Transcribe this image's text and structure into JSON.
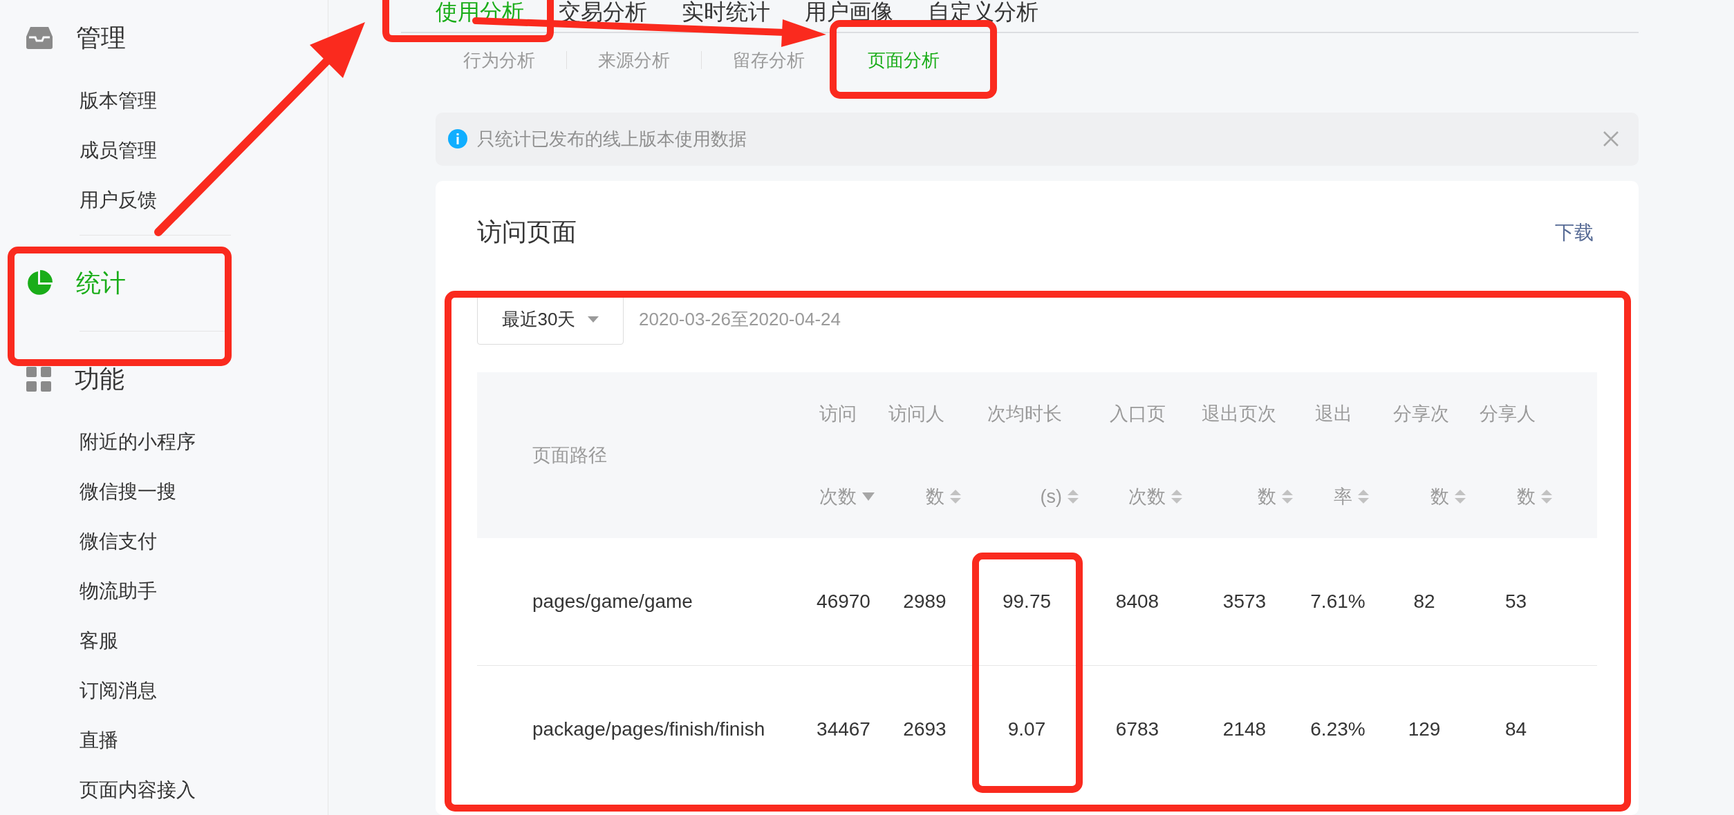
{
  "sidebar": {
    "sections": [
      {
        "label": "管理",
        "selected": false,
        "items": [
          "版本管理",
          "成员管理",
          "用户反馈"
        ]
      },
      {
        "label": "统计",
        "selected": true
      },
      {
        "label": "功能",
        "selected": false,
        "items": [
          "附近的小程序",
          "微信搜一搜",
          "微信支付",
          "物流助手",
          "客服",
          "订阅消息",
          "直播",
          "页面内容接入"
        ]
      }
    ]
  },
  "tabs": [
    {
      "label": "使用分析",
      "selected": true
    },
    {
      "label": "交易分析",
      "selected": false
    },
    {
      "label": "实时统计",
      "selected": false
    },
    {
      "label": "用户画像",
      "selected": false
    },
    {
      "label": "自定义分析",
      "selected": false
    }
  ],
  "subtabs": [
    {
      "label": "行为分析",
      "selected": false
    },
    {
      "label": "来源分析",
      "selected": false
    },
    {
      "label": "留存分析",
      "selected": false
    },
    {
      "label": "页面分析",
      "selected": true
    }
  ],
  "notice": {
    "text": "只统计已发布的线上版本使用数据"
  },
  "card": {
    "title": "访问页面",
    "download": "下载",
    "range_select": {
      "value": "最近30天"
    },
    "date_range": "2020-03-26至2020-04-24"
  },
  "table": {
    "columns": [
      {
        "label": "页面路径",
        "sortable": false
      },
      {
        "label": "访问次数",
        "sortable": true,
        "sorted": true
      },
      {
        "label": "访问人数",
        "sortable": true,
        "sorted": false
      },
      {
        "label": "次均时长(s)",
        "sortable": true,
        "sorted": false
      },
      {
        "label": "入口页次数",
        "sortable": true,
        "sorted": false
      },
      {
        "label": "退出页次数",
        "sortable": true,
        "sorted": false
      },
      {
        "label": "退出率",
        "sortable": true,
        "sorted": false
      },
      {
        "label": "分享次数",
        "sortable": true,
        "sorted": false
      },
      {
        "label": "分享人数",
        "sortable": true,
        "sorted": false
      }
    ],
    "rows": [
      [
        "pages/game/game",
        "46970",
        "2989",
        "99.75",
        "8408",
        "3573",
        "7.61%",
        "82",
        "53"
      ],
      [
        "package/pages/finish/finish",
        "34467",
        "2693",
        "9.07",
        "6783",
        "2148",
        "6.23%",
        "129",
        "84"
      ]
    ]
  }
}
